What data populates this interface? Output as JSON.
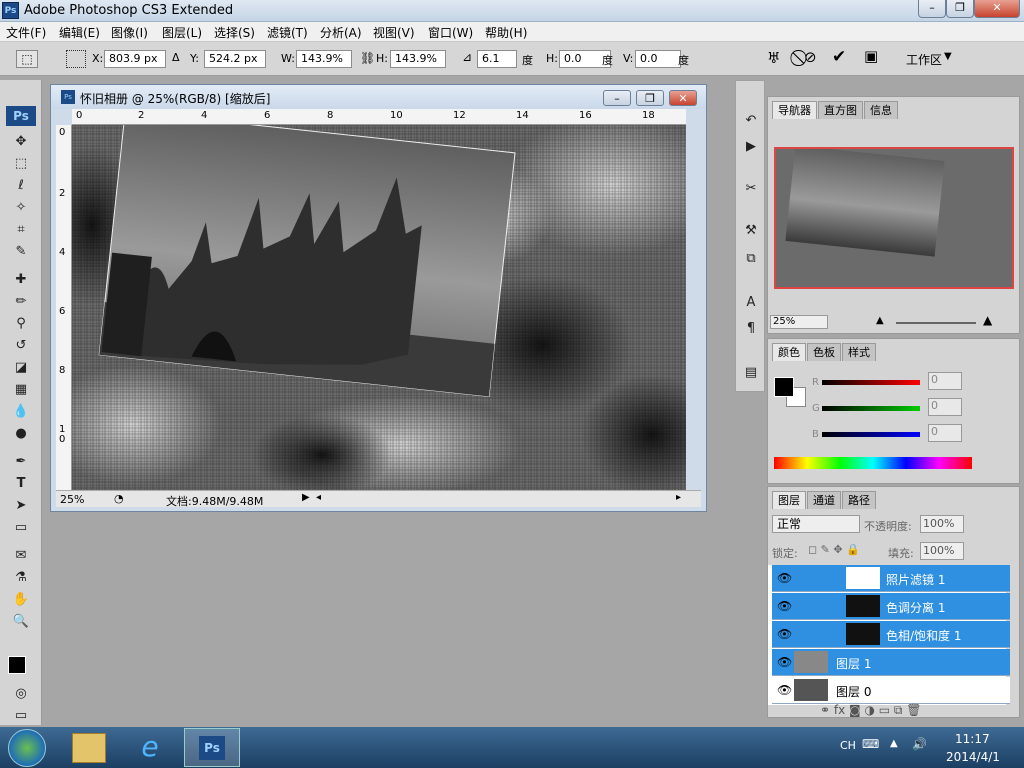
{
  "app": {
    "title": "Adobe Photoshop CS3 Extended",
    "logo": "Ps"
  },
  "window_controls": {
    "minimize": "–",
    "maximize": "❐",
    "close": "✕"
  },
  "menu": [
    "文件(F)",
    "编辑(E)",
    "图像(I)",
    "图层(L)",
    "选择(S)",
    "滤镜(T)",
    "分析(A)",
    "视图(V)",
    "窗口(W)",
    "帮助(H)"
  ],
  "options": {
    "x_label": "X:",
    "x_value": "803.9 px",
    "y_label": "Y:",
    "y_value": "524.2 px",
    "w_label": "W:",
    "w_value": "143.9%",
    "h_label": "H:",
    "h_value": "143.9%",
    "angle_value": "6.1",
    "angle_unit": "度",
    "hskew_label": "H:",
    "hskew_value": "0.0",
    "hskew_unit": "度",
    "vskew_label": "V:",
    "vskew_value": "0.0",
    "vskew_unit": "度",
    "workspace": "工作区"
  },
  "document": {
    "title": "怀旧相册 @ 25%(RGB/8) [缩放后]",
    "zoom": "25%",
    "status": "文档:9.48M/9.48M",
    "ruler_h": [
      "0",
      "2",
      "4",
      "6",
      "8",
      "10",
      "12",
      "14",
      "16",
      "18"
    ],
    "ruler_v": [
      "0",
      "2",
      "4",
      "6",
      "8",
      "1",
      "0"
    ]
  },
  "navigator": {
    "tabs": [
      "导航器",
      "直方图",
      "信息"
    ],
    "zoom": "25%"
  },
  "color": {
    "tabs": [
      "颜色",
      "色板",
      "样式"
    ],
    "channels": [
      {
        "label": "R",
        "value": "0",
        "color": "#cc0000"
      },
      {
        "label": "G",
        "value": "0",
        "color": "#00b400"
      },
      {
        "label": "B",
        "value": "0",
        "color": "#0000cc"
      }
    ]
  },
  "layers": {
    "tabs": [
      "图层",
      "通道",
      "路径"
    ],
    "blend": "正常",
    "opacity_label": "不透明度:",
    "opacity": "100%",
    "lock_label": "锁定:",
    "fill_label": "填充:",
    "fill": "100%",
    "items": [
      {
        "name": "照片滤镜 1",
        "selected": true
      },
      {
        "name": "色调分离 1",
        "selected": true
      },
      {
        "name": "色相/饱和度 1",
        "selected": true
      },
      {
        "name": "图层 1",
        "selected": true
      },
      {
        "name": "图层 0",
        "selected": false
      }
    ]
  },
  "taskbar": {
    "lang": "CH",
    "time": "11:17",
    "date": "2014/4/1"
  }
}
